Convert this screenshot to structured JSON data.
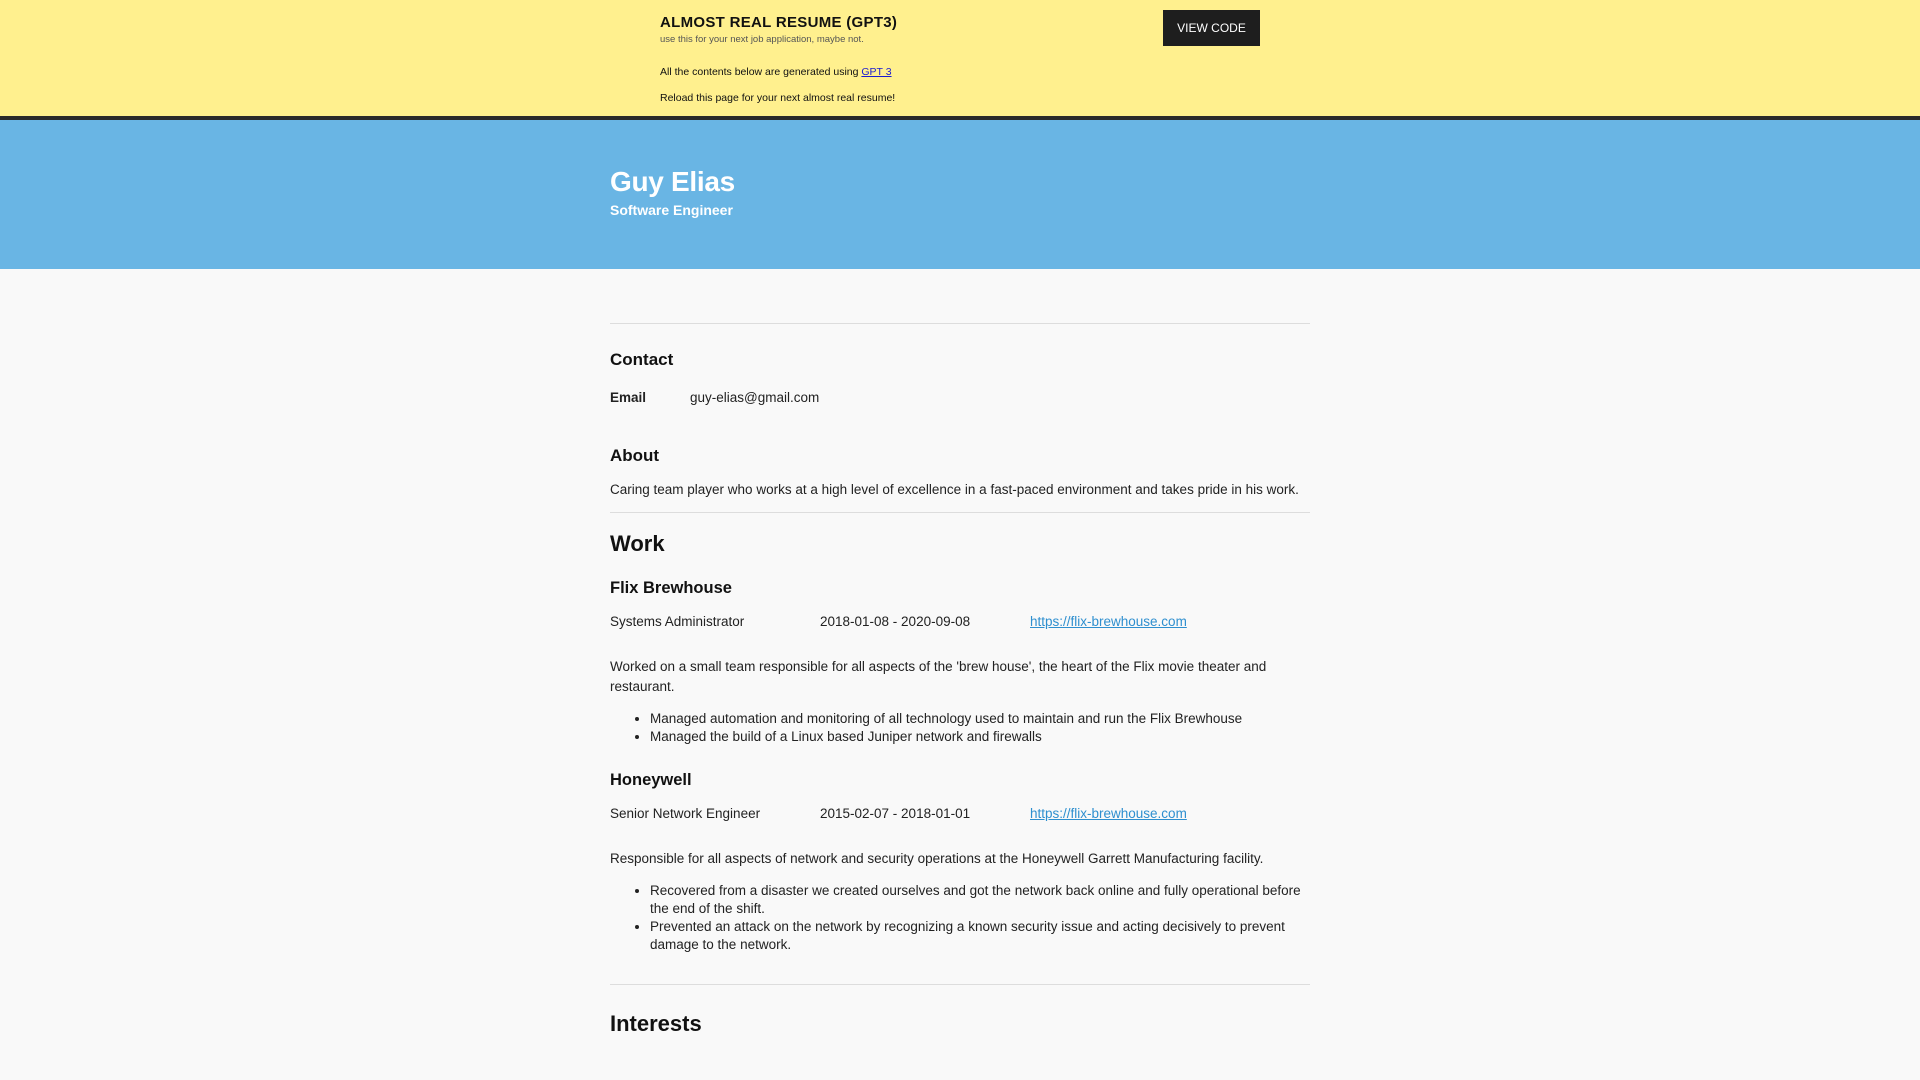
{
  "banner": {
    "title": "ALMOST REAL RESUME (GPT3)",
    "subtitle": "use this for your next job application, maybe not.",
    "generated_prefix": "All the contents below are generated using",
    "generated_link": "GPT 3",
    "reload_text": "Reload this page for your next almost real resume!",
    "view_code_label": "VIEW CODE"
  },
  "hero": {
    "name": "Guy Elias",
    "role": "Software Engineer"
  },
  "contact": {
    "heading": "Contact",
    "email_label": "Email",
    "email_value": "guy-elias@gmail.com"
  },
  "about": {
    "heading": "About",
    "text": "Caring team player who works at a high level of excellence in a fast-paced environment and takes pride in his work."
  },
  "work": {
    "heading": "Work",
    "jobs": [
      {
        "company": "Flix Brewhouse",
        "title": "Systems Administrator",
        "dates": "2018-01-08 - 2020-09-08",
        "url": "https://flix-brewhouse.com",
        "summary": "Worked on a small team responsible for all aspects of the 'brew house', the heart of the Flix movie theater and restaurant.",
        "highlights": [
          "Managed automation and monitoring of all technology used to maintain and run the Flix Brewhouse",
          "Managed the build of a Linux based Juniper network and firewalls"
        ]
      },
      {
        "company": "Honeywell",
        "title": "Senior Network Engineer",
        "dates": "2015-02-07 - 2018-01-01",
        "url": "https://flix-brewhouse.com",
        "summary": "Responsible for all aspects of network and security operations at the Honeywell Garrett Manufacturing facility.",
        "highlights": [
          "Recovered from a disaster we created ourselves and got the network back online and fully operational before the end of the shift.",
          "Prevented an attack on the network by recognizing a known security issue and acting decisively to prevent damage to the network."
        ]
      }
    ]
  },
  "interests": {
    "heading": "Interests"
  }
}
